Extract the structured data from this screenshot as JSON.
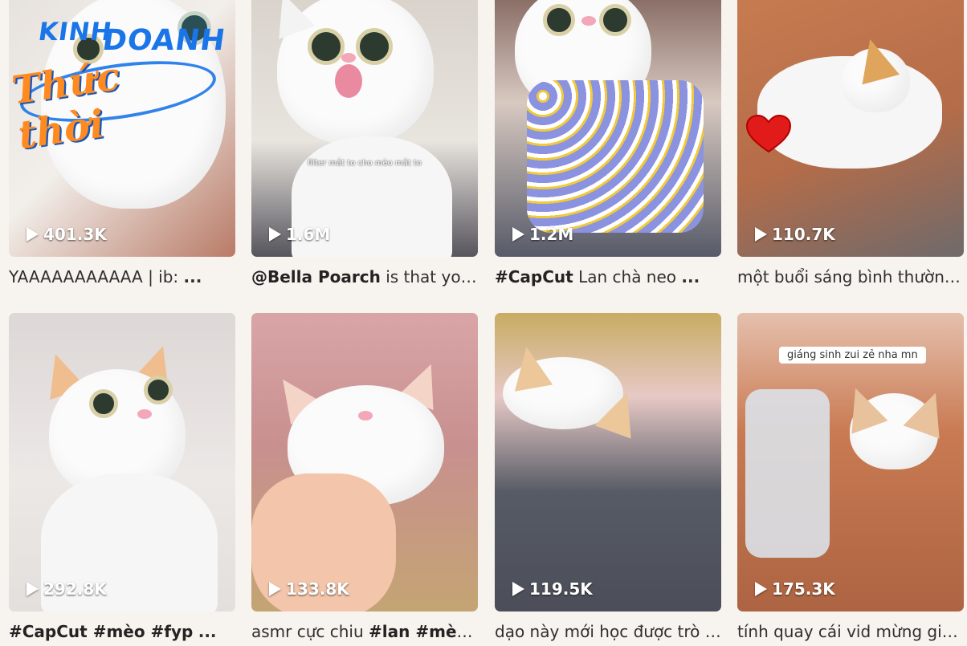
{
  "watermark": {
    "line1": "KINH",
    "line2": "DOANH",
    "line3": "Thức thời"
  },
  "overlay": {
    "card2_text": "filter mắt to cho mèo mắt to",
    "card8_bubble": "giáng sinh zui zẻ nha mn"
  },
  "videos": [
    {
      "views": "401.3K",
      "caption_text": "YAAAAAAAAAAA | ib: ",
      "tags": "",
      "suffix": "..."
    },
    {
      "views": "1.6M",
      "caption_prefix": "@Bella Poarch",
      "caption_text": " is that you",
      "suffix": "..."
    },
    {
      "views": "1.2M",
      "caption_prefix": "#CapCut",
      "caption_text": " Lan chà neo ",
      "suffix": "..."
    },
    {
      "views": "110.7K",
      "caption_text": "một buổi sáng bình thường",
      "suffix": "..."
    },
    {
      "views": "292.8K",
      "caption_prefix": "#CapCut #mèo #fyp",
      "caption_text": " ",
      "suffix": "..."
    },
    {
      "views": "133.8K",
      "caption_text": "asmr cực chiu ",
      "caption_prefix2": "#lan #mèo",
      "suffix": "..."
    },
    {
      "views": "119.5K",
      "caption_text": "dạo này mới học được trò ",
      "suffix": "..."
    },
    {
      "views": "175.3K",
      "caption_text": "tính quay cái vid mừng giá",
      "suffix": "..."
    }
  ],
  "colors": {
    "background": "#f7f3ef",
    "watermark_blue": "#1a75e8",
    "watermark_orange": "#ff8a1f"
  },
  "icons": [
    "play-icon",
    "heart-icon"
  ]
}
